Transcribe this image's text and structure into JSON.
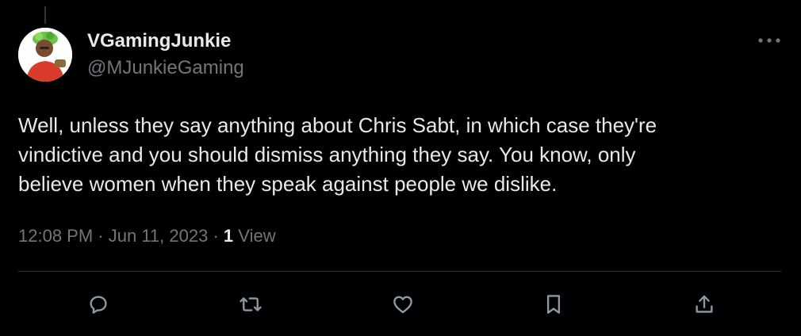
{
  "author": {
    "display_name": "VGamingJunkie",
    "handle": "@MJunkieGaming",
    "avatar_icon": "avatar-cartoon-icon"
  },
  "tweet": {
    "text_lines": [
      "Well, unless they say anything about Chris Sabt, in which case they're",
      "vindictive and you should dismiss anything they say. You know, only",
      "believe women when they speak against people we dislike."
    ],
    "time": "12:08 PM",
    "date": "Jun 11, 2023",
    "separator": "·",
    "views_count": "1",
    "views_label": "View"
  },
  "actions": {
    "icons": [
      "reply-icon",
      "retweet-icon",
      "like-icon",
      "bookmark-icon",
      "share-icon"
    ]
  },
  "colors": {
    "background": "#000000",
    "text_primary": "#e7e9ea",
    "text_secondary": "#71767b",
    "divider": "#2f3336"
  }
}
